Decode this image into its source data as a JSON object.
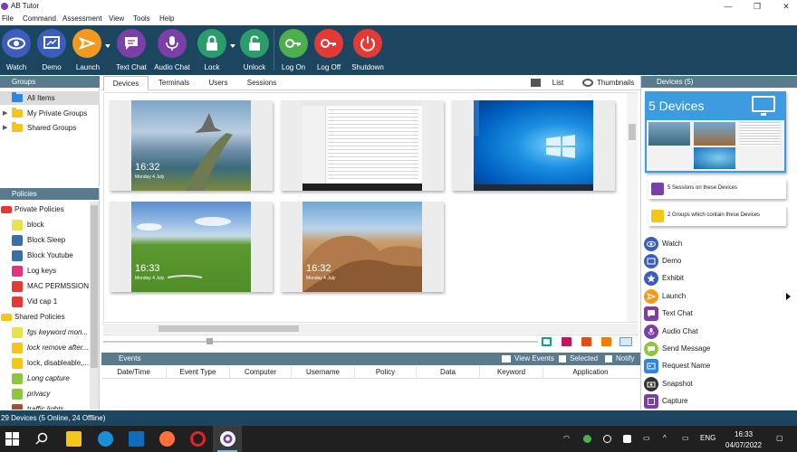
{
  "window": {
    "title": "AB Tutor",
    "minimize": "—",
    "maximize": "❐",
    "close": "✕"
  },
  "menu": [
    "File",
    "Command",
    "Assessment",
    "View",
    "Tools",
    "Help"
  ],
  "toolbar": {
    "watch": "Watch",
    "demo": "Demo",
    "launch": "Launch",
    "text_chat": "Text Chat",
    "audio_chat": "Audio Chat",
    "lock": "Lock",
    "unlock": "Unlock",
    "log_on": "Log On",
    "log_off": "Log Off",
    "shutdown": "Shutdown"
  },
  "groups": {
    "header": "Groups",
    "items": [
      "All Items",
      "My Private Groups",
      "Shared Groups"
    ]
  },
  "policies": {
    "header": "Policies",
    "private_header": "Private Policies",
    "private": [
      "block",
      "Block Sleep",
      "Block Youtube",
      "Log keys",
      "MAC PERMSSIONS",
      "Vid cap 1"
    ],
    "shared_header": "Shared Policies",
    "shared": [
      "fgs keyword mon...",
      "lock remove after...",
      "lock, disableable,...",
      "Long capture",
      "privacy",
      "traffic lights"
    ]
  },
  "tabs": [
    "Devices",
    "Terminals",
    "Users",
    "Sessions"
  ],
  "view_modes": {
    "list": "List",
    "thumbnails": "Thumbnails"
  },
  "thumbnails": [
    {
      "time": "16:32",
      "date": "Monday 4 July"
    },
    {
      "time": "",
      "date": ""
    },
    {
      "time": "",
      "date": ""
    },
    {
      "time": "16:33",
      "date": "Monday 4 July"
    },
    {
      "time": "16:32",
      "date": "Monday 4 July"
    }
  ],
  "events": {
    "header": "Events",
    "view_events": "View Events",
    "selected": "Selected",
    "notify": "Notify",
    "columns": [
      "Date/Time",
      "Event Type",
      "Computer",
      "Username",
      "Policy",
      "Data",
      "Keyword",
      "Application"
    ]
  },
  "right_panel": {
    "header": "Devices (5)",
    "summary_title": "5 Devices",
    "sessions_info": "5 Sessions on these Devices",
    "groups_info": "2 Groups which contain these Devices",
    "actions": [
      "Watch",
      "Demo",
      "Exhibit",
      "Launch",
      "Text Chat",
      "Audio Chat",
      "Send Message",
      "Request Name",
      "Snapshot",
      "Capture"
    ]
  },
  "status": "29 Devices (5 Online, 24 Offline)",
  "taskbar": {
    "lang": "ENG",
    "time": "16:33",
    "date": "04/07/2022"
  },
  "colors": {
    "toolbar_bg": "#1c4660",
    "panel_head": "#5a7a8e",
    "watch": "#3d5dbd",
    "demo": "#3d5dbd",
    "launch": "#f29a1d",
    "chat": "#7a3fa8",
    "lock": "#2a9d6a",
    "log_on": "#4cae4c",
    "log_off": "#e53935",
    "shutdown": "#e53935"
  }
}
